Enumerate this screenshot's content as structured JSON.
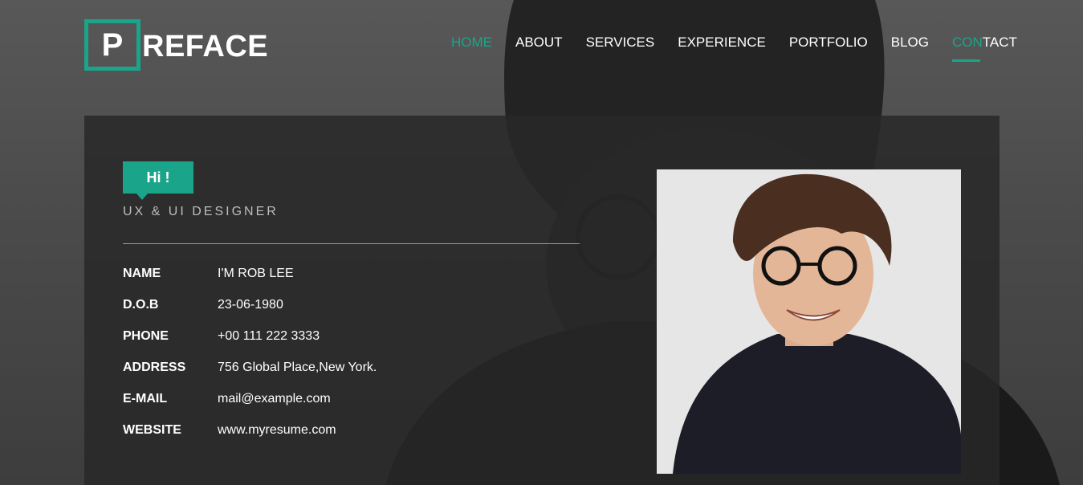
{
  "logo": {
    "letter": "P",
    "text": "REFACE"
  },
  "nav": {
    "items": [
      {
        "label": "HOME"
      },
      {
        "label": "ABOUT"
      },
      {
        "label": "SERVICES"
      },
      {
        "label": "EXPERIENCE"
      },
      {
        "label": "PORTFOLIO"
      },
      {
        "label": "BLOG"
      }
    ],
    "contact_first": "CON",
    "contact_rest": "TACT"
  },
  "profile": {
    "greeting": "Hi !",
    "role": "UX & UI DESIGNER",
    "rows": [
      {
        "label": "NAME",
        "value": "I'M ROB LEE"
      },
      {
        "label": "D.O.B",
        "value": "23-06-1980"
      },
      {
        "label": "PHONE",
        "value": "+00 111 222 3333"
      },
      {
        "label": "ADDRESS",
        "value": "756 Global Place,New York."
      },
      {
        "label": "E-MAIL",
        "value": "mail@example.com"
      },
      {
        "label": "WEBSITE",
        "value": "www.myresume.com"
      }
    ]
  },
  "colors": {
    "accent": "#1aa58a"
  }
}
